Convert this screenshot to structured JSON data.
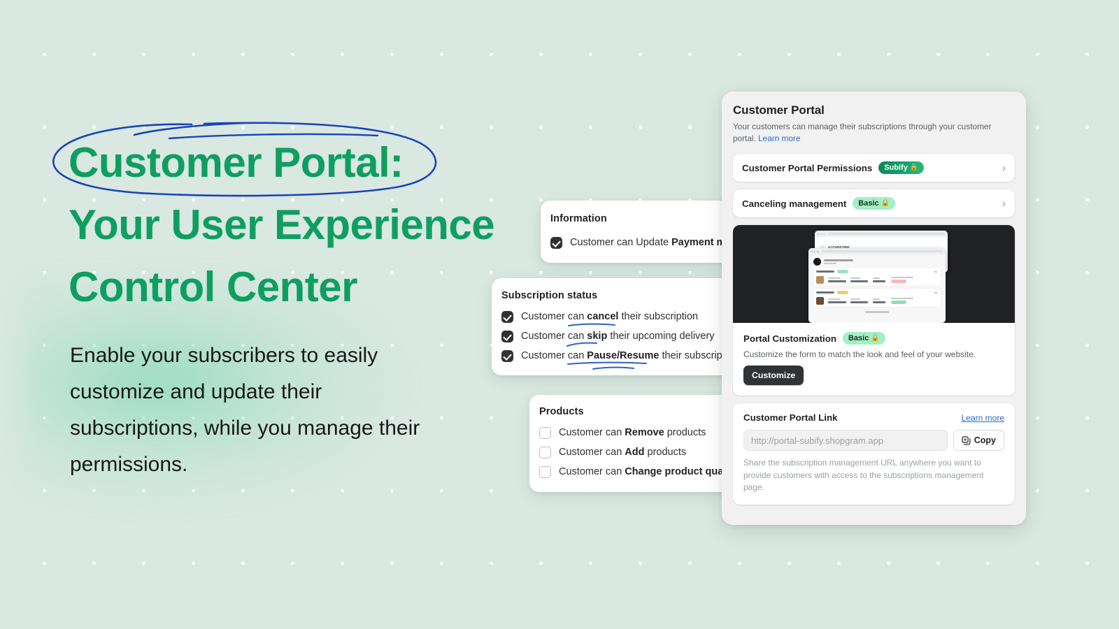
{
  "hero": {
    "headline_line1": "Customer Portal:",
    "headline_line2": "Your User Experience",
    "headline_line3": "Control Center",
    "paragraph": "Enable your subscribers to easily customize and update their subscriptions, while you manage their permissions.",
    "accent_green": "#0f9e62",
    "annotation_blue": "#1a44b8",
    "background": "#d9e8e1"
  },
  "cards": {
    "information": {
      "title": "Information",
      "rows": [
        {
          "prefix": "Customer can Update ",
          "bold": "Payment method",
          "suffix": "",
          "checked": true
        }
      ]
    },
    "subscription_status": {
      "title": "Subscription status",
      "rows": [
        {
          "prefix": "Customer can ",
          "bold": "cancel",
          "suffix": " their subscription",
          "checked": true
        },
        {
          "prefix": "Customer can ",
          "bold": "skip",
          "suffix": " their upcoming delivery",
          "checked": true
        },
        {
          "prefix": "Customer can ",
          "bold": "Pause/Resume",
          "suffix": " their subscription renew",
          "checked": true
        }
      ]
    },
    "products": {
      "title": "Products",
      "rows": [
        {
          "prefix": "Customer can ",
          "bold": "Remove",
          "suffix": " products",
          "checked": false
        },
        {
          "prefix": "Customer can ",
          "bold": "Add",
          "suffix": " products",
          "checked": false
        },
        {
          "prefix": "Customer can ",
          "bold": "Change product quantity",
          "suffix": "",
          "checked": false
        }
      ]
    }
  },
  "panel": {
    "title": "Customer Portal",
    "subtitle": "Your customers can manage their subscriptions through your customer portal.",
    "subtitle_link": "Learn more",
    "rows": [
      {
        "label": "Customer Portal Permissions",
        "badge": "Subify",
        "badge_kind": "subify",
        "chevron": "›"
      },
      {
        "label": "Canceling management",
        "badge": "Basic",
        "badge_kind": "basic",
        "chevron": "›"
      }
    ],
    "customization": {
      "title": "Portal Customization",
      "badge": "Basic",
      "description": "Customize the form to match the look and feel of your website.",
      "button": "Customize"
    },
    "portal_link": {
      "title": "Customer Portal Link",
      "learn_more": "Learn more",
      "input_placeholder": "http://portal-subify.shopgram.app",
      "copy_button": "Copy",
      "note": "Share the subscription management URL anywhere you want to provide customers with access to the subscriptions management page."
    },
    "badge_colors": {
      "subify_bg": "#13a368",
      "subify_text": "#ffffff",
      "basic_bg": "#a2efc4",
      "basic_text": "#17301f"
    }
  }
}
